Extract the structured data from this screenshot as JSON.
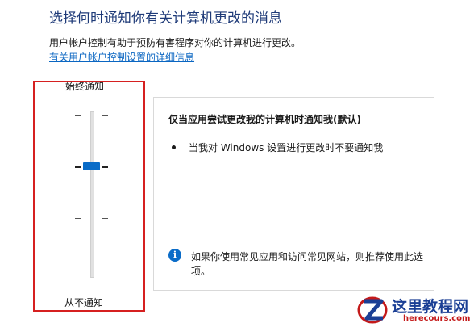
{
  "header": {
    "title": "选择何时通知你有关计算机更改的消息",
    "description": "用户帐户控制有助于预防有害程序对你的计算机进行更改。",
    "link": "有关用户帐户控制设置的详细信息"
  },
  "slider": {
    "top_label": "始终通知",
    "bottom_label": "从不通知",
    "levels": 4,
    "selected_level_from_bottom": 3
  },
  "panel": {
    "heading": "仅当应用尝试更改我的计算机时通知我(默认)",
    "bullet": "当我对 Windows 设置进行更改时不要通知我",
    "tip": "如果你使用常见应用和访问常见网站，则推荐使用此选项。"
  },
  "watermark": {
    "title": "这里教程网",
    "url": "herecours.com"
  },
  "colors": {
    "accent": "#0a6cc8",
    "highlight_border": "#d62020",
    "title": "#1e3a78"
  }
}
